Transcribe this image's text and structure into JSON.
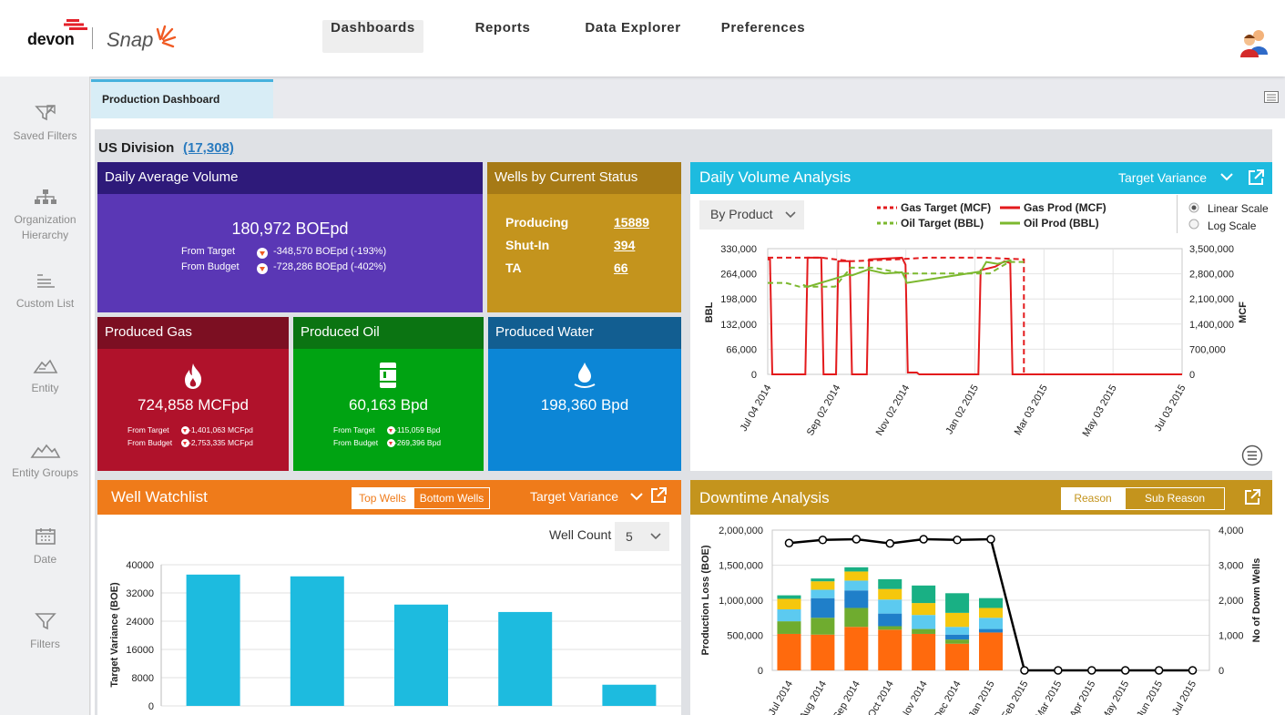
{
  "brand": {
    "company": "devon",
    "app": "Snap"
  },
  "nav": [
    "Dashboards",
    "Reports",
    "Data Explorer",
    "Preferences"
  ],
  "sidebar": [
    "Saved Filters",
    "Organization Hierarchy",
    "Custom List",
    "Entity",
    "Entity Groups",
    "Date",
    "Filters"
  ],
  "tab": "Production Dashboard",
  "division": {
    "label": "US Division",
    "count": "(17,308)"
  },
  "daily_avg": {
    "title": "Daily Average Volume",
    "value": "180,972 BOEpd",
    "target_label": "From Target",
    "target_value": "-348,570 BOEpd (-193%)",
    "budget_label": "From Budget",
    "budget_value": "-728,286 BOEpd (-402%)"
  },
  "wells_status": {
    "title": "Wells by Current Status",
    "rows": [
      {
        "label": "Producing",
        "value": "15889"
      },
      {
        "label": "Shut-In",
        "value": "394"
      },
      {
        "label": "TA",
        "value": "66"
      }
    ]
  },
  "gas": {
    "title": "Produced Gas",
    "value": "724,858 MCFpd",
    "target_label": "From Target",
    "target_value": "-1,401,063 MCFpd",
    "budget_label": "From Budget",
    "budget_value": "-2,753,335 MCFpd"
  },
  "oil": {
    "title": "Produced Oil",
    "value": "60,163 Bpd",
    "target_label": "From Target",
    "target_value": "-115,059 Bpd",
    "budget_label": "From Budget",
    "budget_value": "-269,396 Bpd"
  },
  "water": {
    "title": "Produced Water",
    "value": "198,360 Bpd"
  },
  "volume_analysis": {
    "title": "Daily Volume Analysis",
    "dropdown": "Target Variance",
    "filter": "By Product",
    "scale_linear": "Linear Scale",
    "scale_log": "Log Scale"
  },
  "watchlist": {
    "title": "Well Watchlist",
    "btn_top": "Top Wells",
    "btn_bottom": "Bottom Wells",
    "dropdown": "Target Variance",
    "well_count_label": "Well Count",
    "well_count_value": "5"
  },
  "downtime": {
    "title": "Downtime Analysis",
    "btn_reason": "Reason",
    "btn_sub": "Sub Reason"
  },
  "colors": {
    "purple_head": "#2e1a7a",
    "purple_body": "#5a37b5",
    "gold": "#b8871f",
    "cyan": "#1dbbdf",
    "orange": "#ef7b1a",
    "red": "#b0122b",
    "green": "#00a312",
    "blue": "#0c86d6"
  },
  "chart_data": [
    {
      "type": "line",
      "title": "",
      "xlabel": "",
      "ylabel": "BBL",
      "y2label": "MCF",
      "x_ticks": [
        "Jul 04 2014",
        "Sep 02 2014",
        "Nov 02 2014",
        "Jan 02 2015",
        "Mar 03 2015",
        "May 03 2015",
        "Jul 03 2015"
      ],
      "y_ticks": [
        "0",
        "66,000",
        "132,000",
        "198,000",
        "264,000",
        "330,000"
      ],
      "y2_ticks": [
        "0",
        "700,000",
        "1,400,000",
        "2,100,000",
        "2,800,000",
        "3,500,000"
      ],
      "ylim": [
        0,
        330000
      ],
      "y2lim": [
        0,
        3500000
      ],
      "legend": "top-center",
      "series": [
        {
          "name": "Gas Target (MCF)",
          "style": "dashed",
          "color": "#e31a1c",
          "axis": "right",
          "points": [
            [
              "2014-07-04",
              3250000
            ],
            [
              "2014-08-20",
              3250000
            ],
            [
              "2014-09-15",
              3150000
            ],
            [
              "2014-10-25",
              3200000
            ],
            [
              "2014-11-20",
              3250000
            ],
            [
              "2015-01-10",
              3250000
            ],
            [
              "2015-02-14",
              3200000
            ],
            [
              "2015-02-14",
              0
            ],
            [
              "2015-07-03",
              0
            ]
          ]
        },
        {
          "name": "Gas Prod (MCF)",
          "style": "solid",
          "color": "#e31a1c",
          "axis": "right",
          "points": [
            [
              "2014-07-04",
              3200000
            ],
            [
              "2014-07-06",
              3200000
            ],
            [
              "2014-07-08",
              0
            ],
            [
              "2014-08-06",
              0
            ],
            [
              "2014-08-08",
              3250000
            ],
            [
              "2014-08-20",
              3250000
            ],
            [
              "2014-08-22",
              0
            ],
            [
              "2014-09-02",
              0
            ],
            [
              "2014-09-04",
              3150000
            ],
            [
              "2014-09-14",
              3150000
            ],
            [
              "2014-09-16",
              0
            ],
            [
              "2014-09-29",
              0
            ],
            [
              "2014-10-01",
              3200000
            ],
            [
              "2014-10-30",
              3250000
            ],
            [
              "2014-11-02",
              3050000
            ],
            [
              "2014-11-04",
              50000
            ],
            [
              "2014-11-12",
              50000
            ],
            [
              "2014-11-14",
              0
            ],
            [
              "2015-01-05",
              0
            ],
            [
              "2015-01-07",
              2900000
            ],
            [
              "2015-01-20",
              3000000
            ],
            [
              "2015-01-28",
              3150000
            ],
            [
              "2015-02-02",
              3100000
            ],
            [
              "2015-02-04",
              0
            ],
            [
              "2015-07-03",
              0
            ]
          ]
        },
        {
          "name": "Oil Target (BBL)",
          "style": "dashed",
          "color": "#7cb82f",
          "axis": "left",
          "points": [
            [
              "2014-07-04",
              240000
            ],
            [
              "2014-07-20",
              240000
            ],
            [
              "2014-08-01",
              230000
            ],
            [
              "2014-09-01",
              230000
            ],
            [
              "2014-09-15",
              280000
            ],
            [
              "2014-10-05",
              280000
            ],
            [
              "2014-10-31",
              265000
            ],
            [
              "2014-11-15",
              265000
            ],
            [
              "2015-01-15",
              265000
            ],
            [
              "2015-02-01",
              295000
            ],
            [
              "2015-02-14",
              295000
            ]
          ]
        },
        {
          "name": "Oil Prod (BBL)",
          "style": "solid",
          "color": "#7cb82f",
          "axis": "left",
          "points": [
            [
              "2014-08-04",
              235000
            ],
            [
              "2014-08-08",
              230000
            ],
            [
              "2014-09-13",
              262000
            ],
            [
              "2014-09-16",
              260000
            ],
            [
              "2014-09-30",
              275000
            ],
            [
              "2014-10-15",
              265000
            ],
            [
              "2014-10-30",
              268000
            ],
            [
              "2014-11-02",
              250000
            ],
            [
              "2014-11-03",
              240000
            ],
            [
              "2015-01-07",
              270000
            ],
            [
              "2015-01-12",
              295000
            ],
            [
              "2015-01-22",
              290000
            ],
            [
              "2015-02-03",
              300000
            ]
          ]
        }
      ]
    },
    {
      "type": "bar",
      "title": "",
      "xlabel": "",
      "ylabel": "Target Variance (BOE)",
      "categories": [
        "",
        "",
        "",
        "",
        ""
      ],
      "values": [
        37200,
        36700,
        28700,
        26600,
        6000
      ],
      "y_ticks": [
        "0",
        "8000",
        "16000",
        "24000",
        "32000",
        "40000"
      ],
      "ylim": [
        0,
        40000
      ]
    },
    {
      "type": "bar",
      "title": "",
      "xlabel": "",
      "ylabel": "Production Loss (BOE)",
      "y2label": "No of Down Wells",
      "categories": [
        "Jul 2014",
        "Aug 2014",
        "Sep 2014",
        "Oct 2014",
        "Nov 2014",
        "Dec 2014",
        "Jan 2015",
        "Feb 2015",
        "Mar 2015",
        "Apr 2015",
        "May 2015",
        "Jun 2015",
        "Jul 2015"
      ],
      "y_ticks": [
        "0",
        "500,000",
        "1,000,000",
        "1,500,000",
        "2,000,000"
      ],
      "y2_ticks": [
        "0",
        "1,000",
        "2,000",
        "3,000",
        "4,000"
      ],
      "ylim": [
        0,
        2000000
      ],
      "y2lim": [
        0,
        4000
      ],
      "stacked": true,
      "series": [
        {
          "name": "",
          "color": "#ff6a0d",
          "values": [
            520000,
            510000,
            620000,
            580000,
            520000,
            380000,
            540000,
            0,
            0,
            0,
            0,
            0,
            0
          ]
        },
        {
          "name": "",
          "color": "#6fac2f",
          "values": [
            180000,
            240000,
            270000,
            50000,
            70000,
            60000,
            0,
            0,
            0,
            0,
            0,
            0,
            0
          ]
        },
        {
          "name": "",
          "color": "#1f7fc9",
          "values": [
            0,
            280000,
            250000,
            180000,
            0,
            70000,
            50000,
            0,
            0,
            0,
            0,
            0,
            0
          ]
        },
        {
          "name": "",
          "color": "#5ccaf0",
          "values": [
            170000,
            120000,
            140000,
            200000,
            200000,
            110000,
            160000,
            0,
            0,
            0,
            0,
            0,
            0
          ]
        },
        {
          "name": "",
          "color": "#f5c70d",
          "values": [
            150000,
            120000,
            130000,
            150000,
            170000,
            200000,
            140000,
            0,
            0,
            0,
            0,
            0,
            0
          ]
        },
        {
          "name": "",
          "color": "#19b084",
          "values": [
            50000,
            40000,
            60000,
            140000,
            250000,
            280000,
            140000,
            0,
            0,
            0,
            0,
            0,
            0
          ]
        }
      ],
      "line": {
        "name": "",
        "values": [
          3630,
          3720,
          3740,
          3620,
          3740,
          3720,
          3740,
          0,
          0,
          0,
          0,
          0,
          0
        ]
      }
    }
  ]
}
